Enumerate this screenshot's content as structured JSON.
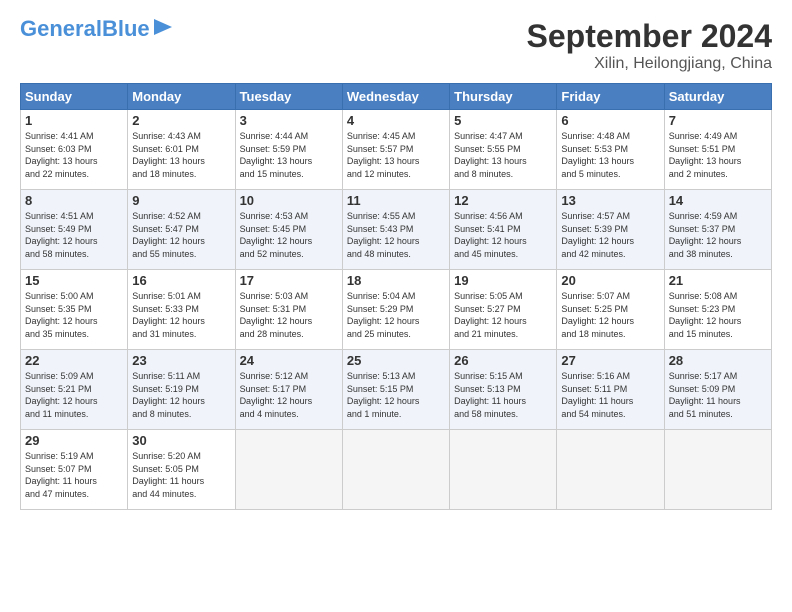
{
  "header": {
    "logo_general": "General",
    "logo_blue": "Blue",
    "month": "September 2024",
    "location": "Xilin, Heilongjiang, China"
  },
  "columns": [
    "Sunday",
    "Monday",
    "Tuesday",
    "Wednesday",
    "Thursday",
    "Friday",
    "Saturday"
  ],
  "weeks": [
    [
      {
        "day": "1",
        "info": "Sunrise: 4:41 AM\nSunset: 6:03 PM\nDaylight: 13 hours\nand 22 minutes."
      },
      {
        "day": "2",
        "info": "Sunrise: 4:43 AM\nSunset: 6:01 PM\nDaylight: 13 hours\nand 18 minutes."
      },
      {
        "day": "3",
        "info": "Sunrise: 4:44 AM\nSunset: 5:59 PM\nDaylight: 13 hours\nand 15 minutes."
      },
      {
        "day": "4",
        "info": "Sunrise: 4:45 AM\nSunset: 5:57 PM\nDaylight: 13 hours\nand 12 minutes."
      },
      {
        "day": "5",
        "info": "Sunrise: 4:47 AM\nSunset: 5:55 PM\nDaylight: 13 hours\nand 8 minutes."
      },
      {
        "day": "6",
        "info": "Sunrise: 4:48 AM\nSunset: 5:53 PM\nDaylight: 13 hours\nand 5 minutes."
      },
      {
        "day": "7",
        "info": "Sunrise: 4:49 AM\nSunset: 5:51 PM\nDaylight: 13 hours\nand 2 minutes."
      }
    ],
    [
      {
        "day": "8",
        "info": "Sunrise: 4:51 AM\nSunset: 5:49 PM\nDaylight: 12 hours\nand 58 minutes."
      },
      {
        "day": "9",
        "info": "Sunrise: 4:52 AM\nSunset: 5:47 PM\nDaylight: 12 hours\nand 55 minutes."
      },
      {
        "day": "10",
        "info": "Sunrise: 4:53 AM\nSunset: 5:45 PM\nDaylight: 12 hours\nand 52 minutes."
      },
      {
        "day": "11",
        "info": "Sunrise: 4:55 AM\nSunset: 5:43 PM\nDaylight: 12 hours\nand 48 minutes."
      },
      {
        "day": "12",
        "info": "Sunrise: 4:56 AM\nSunset: 5:41 PM\nDaylight: 12 hours\nand 45 minutes."
      },
      {
        "day": "13",
        "info": "Sunrise: 4:57 AM\nSunset: 5:39 PM\nDaylight: 12 hours\nand 42 minutes."
      },
      {
        "day": "14",
        "info": "Sunrise: 4:59 AM\nSunset: 5:37 PM\nDaylight: 12 hours\nand 38 minutes."
      }
    ],
    [
      {
        "day": "15",
        "info": "Sunrise: 5:00 AM\nSunset: 5:35 PM\nDaylight: 12 hours\nand 35 minutes."
      },
      {
        "day": "16",
        "info": "Sunrise: 5:01 AM\nSunset: 5:33 PM\nDaylight: 12 hours\nand 31 minutes."
      },
      {
        "day": "17",
        "info": "Sunrise: 5:03 AM\nSunset: 5:31 PM\nDaylight: 12 hours\nand 28 minutes."
      },
      {
        "day": "18",
        "info": "Sunrise: 5:04 AM\nSunset: 5:29 PM\nDaylight: 12 hours\nand 25 minutes."
      },
      {
        "day": "19",
        "info": "Sunrise: 5:05 AM\nSunset: 5:27 PM\nDaylight: 12 hours\nand 21 minutes."
      },
      {
        "day": "20",
        "info": "Sunrise: 5:07 AM\nSunset: 5:25 PM\nDaylight: 12 hours\nand 18 minutes."
      },
      {
        "day": "21",
        "info": "Sunrise: 5:08 AM\nSunset: 5:23 PM\nDaylight: 12 hours\nand 15 minutes."
      }
    ],
    [
      {
        "day": "22",
        "info": "Sunrise: 5:09 AM\nSunset: 5:21 PM\nDaylight: 12 hours\nand 11 minutes."
      },
      {
        "day": "23",
        "info": "Sunrise: 5:11 AM\nSunset: 5:19 PM\nDaylight: 12 hours\nand 8 minutes."
      },
      {
        "day": "24",
        "info": "Sunrise: 5:12 AM\nSunset: 5:17 PM\nDaylight: 12 hours\nand 4 minutes."
      },
      {
        "day": "25",
        "info": "Sunrise: 5:13 AM\nSunset: 5:15 PM\nDaylight: 12 hours\nand 1 minute."
      },
      {
        "day": "26",
        "info": "Sunrise: 5:15 AM\nSunset: 5:13 PM\nDaylight: 11 hours\nand 58 minutes."
      },
      {
        "day": "27",
        "info": "Sunrise: 5:16 AM\nSunset: 5:11 PM\nDaylight: 11 hours\nand 54 minutes."
      },
      {
        "day": "28",
        "info": "Sunrise: 5:17 AM\nSunset: 5:09 PM\nDaylight: 11 hours\nand 51 minutes."
      }
    ],
    [
      {
        "day": "29",
        "info": "Sunrise: 5:19 AM\nSunset: 5:07 PM\nDaylight: 11 hours\nand 47 minutes."
      },
      {
        "day": "30",
        "info": "Sunrise: 5:20 AM\nSunset: 5:05 PM\nDaylight: 11 hours\nand 44 minutes."
      },
      {
        "day": "",
        "info": ""
      },
      {
        "day": "",
        "info": ""
      },
      {
        "day": "",
        "info": ""
      },
      {
        "day": "",
        "info": ""
      },
      {
        "day": "",
        "info": ""
      }
    ]
  ]
}
